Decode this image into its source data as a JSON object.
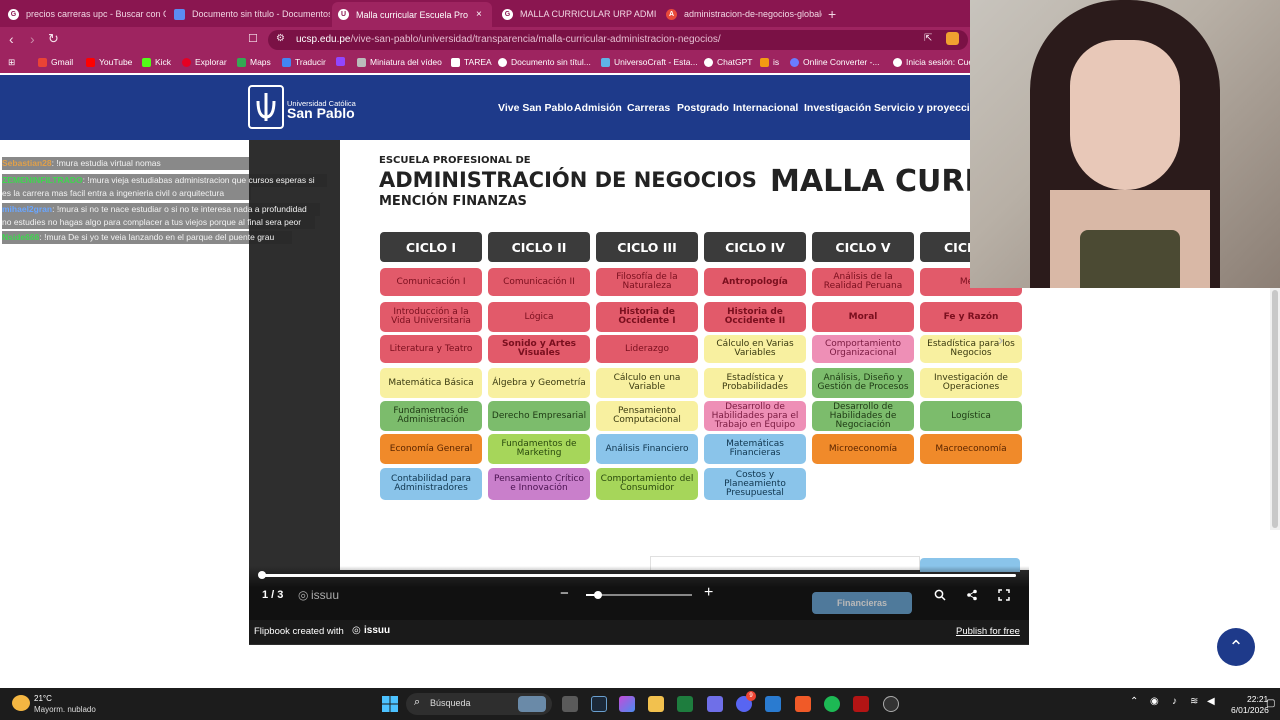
{
  "browser": {
    "tabs": [
      {
        "label": "precios carreras upc - Buscar con Go",
        "icon": "google-icon"
      },
      {
        "label": "Documento sin título - Documentos",
        "icon": "docs-icon"
      },
      {
        "label": "Malla curricular Escuela Profesio",
        "icon": "ucsp-icon",
        "active": true
      },
      {
        "label": "MALLA CURRICULAR URP ADMIN - E",
        "icon": "google-icon"
      },
      {
        "label": "administracion-de-negocios-globale",
        "icon": "pdf-icon"
      }
    ],
    "new_tab": "+",
    "close_tab": "×",
    "url_host": "ucsp.edu.pe",
    "url_path": "/vive-san-pablo/universidad/transparencia/malla-curricular-administracion-negocios/",
    "bookmarks": [
      "Gmail",
      "YouTube",
      "Kick",
      "Explorar",
      "Maps",
      "Traducir",
      "Miniatura del vídeo",
      "TAREA",
      "Documento sin títul...",
      "UniversoCraft - Esta...",
      "ChatGPT",
      "is",
      "Online Converter -...",
      "Inicia sesión: Cuer"
    ]
  },
  "site": {
    "logo_line1": "Universidad Católica",
    "logo_line2": "San Pablo",
    "nav": [
      "Vive San Pablo",
      "Admisión",
      "Carreras",
      "Postgrado",
      "Internacional",
      "Investigación",
      "Servicio y proyección"
    ]
  },
  "document": {
    "eyebrow": "ESCUELA PROFESIONAL DE",
    "title": "ADMINISTRACIÓN DE NEGOCIOS",
    "subtitle": "MENCIÓN FINANZAS",
    "big_title": "MALLA CURRI",
    "cycles": [
      "CICLO I",
      "CICLO II",
      "CICLO III",
      "CICLO IV",
      "CICLO V",
      "CICL"
    ],
    "columns": [
      [
        "Comunicación I",
        "Introducción a la Vida Universitaria",
        "Literatura y Teatro",
        "Matemática Básica",
        "Fundamentos de Administración",
        "Economía General",
        "Contabilidad para Administradores"
      ],
      [
        "Comunicación II",
        "Lógica",
        "Sonido y Artes Visuales",
        "Álgebra y Geometría",
        "Derecho Empresarial",
        "Fundamentos de Marketing",
        "Pensamiento Crítico e Innovación"
      ],
      [
        "Filosofía de la Naturaleza",
        "Historia de Occidente I",
        "Liderazgo",
        "Cálculo en una Variable",
        "Pensamiento Computacional",
        "Análisis Financiero",
        "Comportamiento del Consumidor"
      ],
      [
        "Antropología",
        "Historia de Occidente II",
        "Cálculo en Varias Variables",
        "Estadística y Probabilidades",
        "Desarrollo de Habilidades para el Trabajo en Equipo",
        "Matemáticas Financieras",
        "Costos y Planeamiento Presupuestal"
      ],
      [
        "Análisis de la Realidad Peruana",
        "Moral",
        "Comportamiento Organizacional",
        "Análisis, Diseño y Gestión de Procesos",
        "Desarrollo de Habilidades de Negociación",
        "Microeconomía"
      ],
      [
        "Meta",
        "Fe y Razón",
        "Estadística para los Negocios",
        "Investigación de Operaciones",
        "Logística",
        "Macroeconomía"
      ]
    ],
    "peek_label": "Financieras"
  },
  "reader": {
    "page_indicator": "1 / 3",
    "brand": "issuu",
    "zoom_minus": "−",
    "zoom_plus": "+",
    "zoom_level": 0.1,
    "footer_left": "Flipbook created with",
    "footer_brand": "issuu",
    "footer_right": "Publish for free"
  },
  "chat": [
    {
      "user": "Sebastian28",
      "message": "!mura estudia virtual nomas",
      "user_color": "#e0a04a"
    },
    {
      "user": "ZEMENINFILTRADO",
      "message": "!mura vieja estudiabas administracion que cursos esperas si",
      "user_color": "#3fd64f"
    },
    {
      "user": "",
      "message": "es la carrera mas facil entra a ingenieria civil o arquitectura",
      "user_color": "#ffffff"
    },
    {
      "user": "mihael2gran",
      "message": "!mura si no te nace estudiar o si no te interesa nada a profundidad",
      "user_color": "#6aa6ff"
    },
    {
      "user": "",
      "message": "no estudies no hagas algo para complacer a tus viejos porque al final sera peor",
      "user_color": "#ffffff"
    },
    {
      "user": "Nside666",
      "message": "!mura De si yo te veia lanzando en el parque del puente grau",
      "user_color": "#3fd64f"
    }
  ],
  "taskbar": {
    "weather_temp": "21°C",
    "weather_desc": "Mayorm. nublado",
    "search_placeholder": "Búsqueda",
    "time": "22:21",
    "date": "6/01/2026",
    "badge_count": "9"
  },
  "colors": {
    "tab_bar": "#8a1650",
    "site_header": "#1e3a8a",
    "red": "#e25a6a",
    "pink": "#ee8fb6",
    "yellow": "#f8f0a0",
    "green": "#7cbc6c",
    "orange": "#f08a2a",
    "blue": "#8ac4ea",
    "lime": "#a6d65a",
    "purple": "#c97fcb"
  }
}
